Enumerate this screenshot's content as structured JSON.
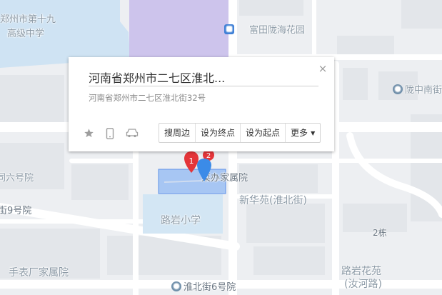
{
  "popup": {
    "title": "河南省郑州市二七区淮北...",
    "address": "河南省郑州市二七区淮北街32号",
    "close_label": "×",
    "actions": [
      "搜周边",
      "设为终点",
      "设为起点",
      "更多"
    ]
  },
  "markers": {
    "red_label": "1",
    "red_badge": "2"
  },
  "labels": {
    "school_top_1": "郑州市第十九",
    "school_top_2": "高级中学",
    "fuitian": "富田陇海花园",
    "longhai_right": "陇中南街",
    "courtyard_6": "同六号院",
    "no9": "街9号院",
    "caiban": "菜办家属院",
    "xinhuayuan": "新华苑(淮北街)",
    "luyan_school": "路岩小学",
    "building_2": "2栋",
    "watch_factory": "手表厂家属院",
    "luyan_garden_1": "路岩花苑",
    "luyan_garden_2": "(汝河路)",
    "huaibei_6": "淮北街6号院"
  },
  "colors": {
    "water": "#cfe3f3",
    "purple": "#cfc6ec",
    "highlight": "#5f92e8",
    "marker_red": "#e4353a",
    "marker_blue": "#3b8be8"
  }
}
